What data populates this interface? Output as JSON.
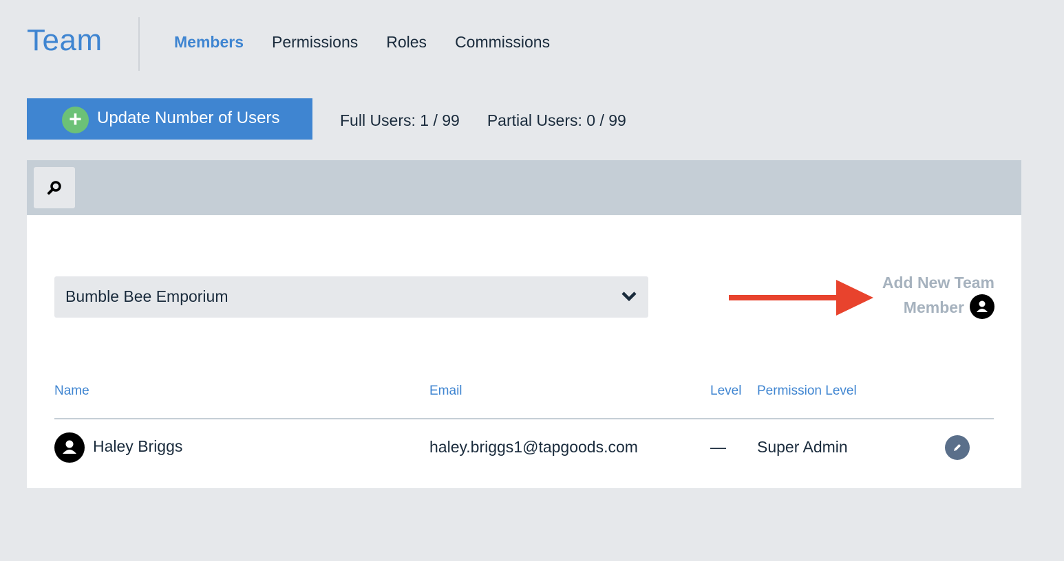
{
  "header": {
    "title": "Team",
    "tabs": [
      {
        "label": "Members",
        "active": true
      },
      {
        "label": "Permissions",
        "active": false
      },
      {
        "label": "Roles",
        "active": false
      },
      {
        "label": "Commissions",
        "active": false
      }
    ]
  },
  "toolbar": {
    "update_button_label": "Update Number of Users",
    "full_users": "Full Users: 1 / 99",
    "partial_users": "Partial Users: 0 / 99"
  },
  "search": {
    "icon": "search-icon"
  },
  "location_select": {
    "selected": "Bumble Bee Emporium",
    "icon": "chevron-down-icon"
  },
  "add_member": {
    "line1": "Add New Team",
    "line2": "Member",
    "icon": "user-icon"
  },
  "table": {
    "columns": [
      "Name",
      "Email",
      "Level",
      "Permission Level"
    ],
    "rows": [
      {
        "name": "Haley Briggs",
        "email": "haley.briggs1@tapgoods.com",
        "level": "—",
        "permission": "Super Admin"
      }
    ]
  },
  "colors": {
    "accent": "#3f85d1",
    "success": "#6cc177",
    "background": "#e6e8eb",
    "toolbar": "#c5ced6",
    "muted": "#a6b2be",
    "arrow": "#e8432d",
    "edit": "#5a6f8a"
  }
}
